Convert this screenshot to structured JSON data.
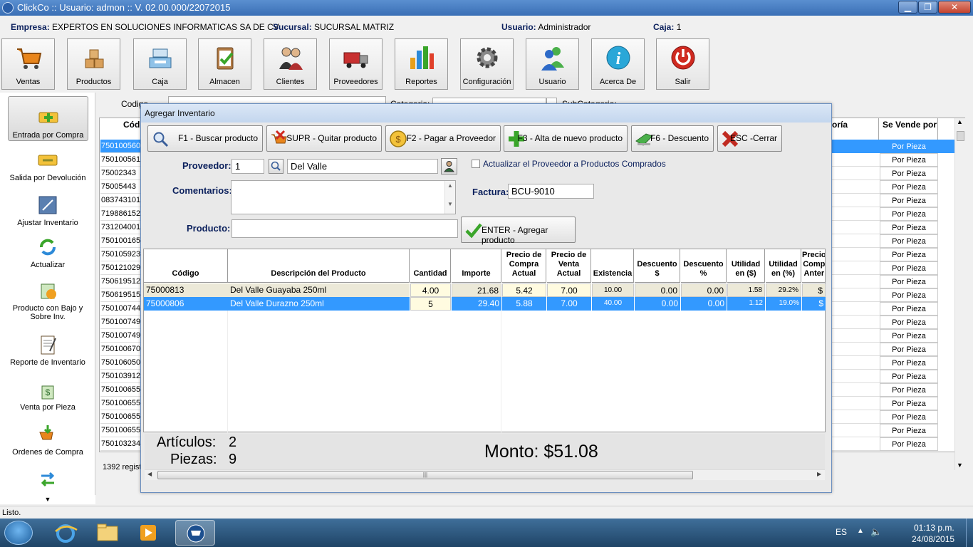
{
  "window": {
    "title": "ClickCo :: Usuario: admon :: V. 02.00.000/22072015"
  },
  "info": {
    "empresa_label": "Empresa:",
    "empresa_value": "EXPERTOS EN SOLUCIONES INFORMATICAS SA DE CV",
    "sucursal_label": "Sucursal:",
    "sucursal_value": "SUCURSAL MATRIZ",
    "usuario_label": "Usuario:",
    "usuario_value": "Administrador",
    "caja_label": "Caja:",
    "caja_value": "1"
  },
  "toolbar": [
    {
      "label": "Ventas",
      "icon": "cart-icon"
    },
    {
      "label": "Productos",
      "icon": "boxes-icon"
    },
    {
      "label": "Caja",
      "icon": "cash-register-icon"
    },
    {
      "label": "Almacen",
      "icon": "clipboard-check-icon"
    },
    {
      "label": "Clientes",
      "icon": "people-icon"
    },
    {
      "label": "Proveedores",
      "icon": "truck-icon"
    },
    {
      "label": "Reportes",
      "icon": "bar-chart-icon"
    },
    {
      "label": "Configuración",
      "icon": "gear-icon"
    },
    {
      "label": "Usuario",
      "icon": "users-icon"
    },
    {
      "label": "Acerca De",
      "icon": "info-icon"
    },
    {
      "label": "Salir",
      "icon": "power-icon"
    }
  ],
  "sidebar": [
    {
      "label": "Entrada por Compra",
      "icon": "add-entry-icon",
      "active": true
    },
    {
      "label": "Salida por Devolución",
      "icon": "remove-entry-icon"
    },
    {
      "label": "Ajustar Inventario",
      "icon": "adjust-icon"
    },
    {
      "label": "Actualizar",
      "icon": "refresh-icon"
    },
    {
      "label": "Producto con Bajo y Sobre Inv.",
      "icon": "low-stock-icon"
    },
    {
      "label": "Reporte de Inventario",
      "icon": "report-icon"
    },
    {
      "label": "Venta por Pieza",
      "icon": "piece-sale-icon"
    },
    {
      "label": "Ordenes de Compra",
      "icon": "purchase-order-icon"
    },
    {
      "label": "",
      "icon": "transfer-icon"
    }
  ],
  "background": {
    "codigo_label": "Codigo",
    "categoria_label": "Categoria:",
    "subcategoria_label": "SubCategoria:",
    "col_codigo": "Códi",
    "col_categoria": "oría",
    "col_sevende": "Se Vende por",
    "codes": [
      "750100560",
      "750100561",
      "75002343",
      "75005443",
      "083743101",
      "719886152",
      "731204001",
      "750100165",
      "750105923",
      "750121029",
      "750619512",
      "750619515",
      "750100744",
      "750100749",
      "750100749",
      "750100670",
      "750106050",
      "750103912",
      "750100655",
      "750100655",
      "750100655",
      "750100655",
      "750103234"
    ],
    "sevende_value": "Por Pieza",
    "records": "1392 regist"
  },
  "dialog": {
    "title": "Agregar Inventario",
    "buttons": [
      {
        "label": "F1 - Buscar producto",
        "icon": "search-icon"
      },
      {
        "label": "SUPR - Quitar producto",
        "icon": "remove-cart-icon"
      },
      {
        "label": "F2 - Pagar a Proveedor",
        "icon": "coin-icon"
      },
      {
        "label": "F3 - Alta de nuevo producto",
        "icon": "plus-icon"
      },
      {
        "label": "F6 - Descuento",
        "icon": "tag-icon"
      },
      {
        "label": "ESC -Cerrar",
        "icon": "close-x-icon"
      }
    ],
    "proveedor_label": "Proveedor:",
    "proveedor_id": "1",
    "proveedor_name": "Del Valle",
    "actualizar_label": "Actualizar el Proveedor a Productos Comprados",
    "comentarios_label": "Comentarios:",
    "factura_label": "Factura:",
    "factura_value": "BCU-9010",
    "producto_label": "Producto:",
    "producto_value": "",
    "agregar_label": "ENTER - Agregar producto",
    "columns": [
      "Código",
      "Descripción del Producto",
      "Cantidad",
      "Importe",
      "Precio de Compra Actual",
      "Precio de Venta Actual",
      "Existencia",
      "Descuento $",
      "Descuento %",
      "Utilidad en ($)",
      "Utilidad en (%)",
      "Precio Comp Anter"
    ],
    "rows": [
      {
        "codigo": "75000813",
        "descripcion": "Del Valle Guayaba 250ml",
        "cantidad": "4.00",
        "importe": "21.68",
        "precio_compra": "5.42",
        "precio_venta": "7.00",
        "existencia": "10.00",
        "desc_monto": "0.00",
        "desc_pct": "0.00",
        "util_monto": "1.58",
        "util_pct": "29.2%",
        "anterior": "$"
      },
      {
        "codigo": "75000806",
        "descripcion": "Del Valle Durazno 250ml",
        "cantidad": "5",
        "importe": "29.40",
        "precio_compra": "5.88",
        "precio_venta": "7.00",
        "existencia": "40.00",
        "desc_monto": "0.00",
        "desc_pct": "0.00",
        "util_monto": "1.12",
        "util_pct": "19.0%",
        "anterior": "$"
      }
    ],
    "articulos_label": "Artículos:",
    "articulos_value": "2",
    "piezas_label": "Piezas:",
    "piezas_value": "9",
    "monto_label": "Monto: $51.08"
  },
  "status": {
    "text": "Listo."
  },
  "taskbar": {
    "lang": "ES",
    "time": "01:13 p.m.",
    "date": "24/08/2015"
  }
}
